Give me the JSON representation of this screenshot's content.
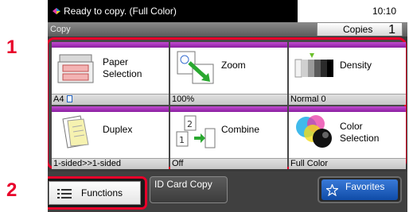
{
  "callouts": [
    "1",
    "2"
  ],
  "status": {
    "message": "Ready to copy. (Full Color)",
    "time": "10:10"
  },
  "header": {
    "title": "Copy",
    "copies_label": "Copies",
    "copies_count": "1"
  },
  "tiles": [
    {
      "label": "Paper Selection",
      "value": "A4",
      "icon": "paper-tray-icon"
    },
    {
      "label": "Zoom",
      "value": "100%",
      "icon": "zoom-icon"
    },
    {
      "label": "Density",
      "value": "Normal 0",
      "icon": "density-icon"
    },
    {
      "label": "Duplex",
      "value": "1-sided>>1-sided",
      "icon": "duplex-icon"
    },
    {
      "label": "Combine",
      "value": "Off",
      "icon": "combine-icon"
    },
    {
      "label": "Color Selection",
      "value": "Full Color",
      "icon": "color-selection-icon"
    }
  ],
  "bottom": {
    "functions_label": "Functions",
    "idcard_label": "ID Card Copy",
    "favorites_label": "Favorites"
  },
  "colors": {
    "highlight": "#e8002a",
    "tile_bar": "#a534b8",
    "favorites": "#1f5fc4"
  }
}
